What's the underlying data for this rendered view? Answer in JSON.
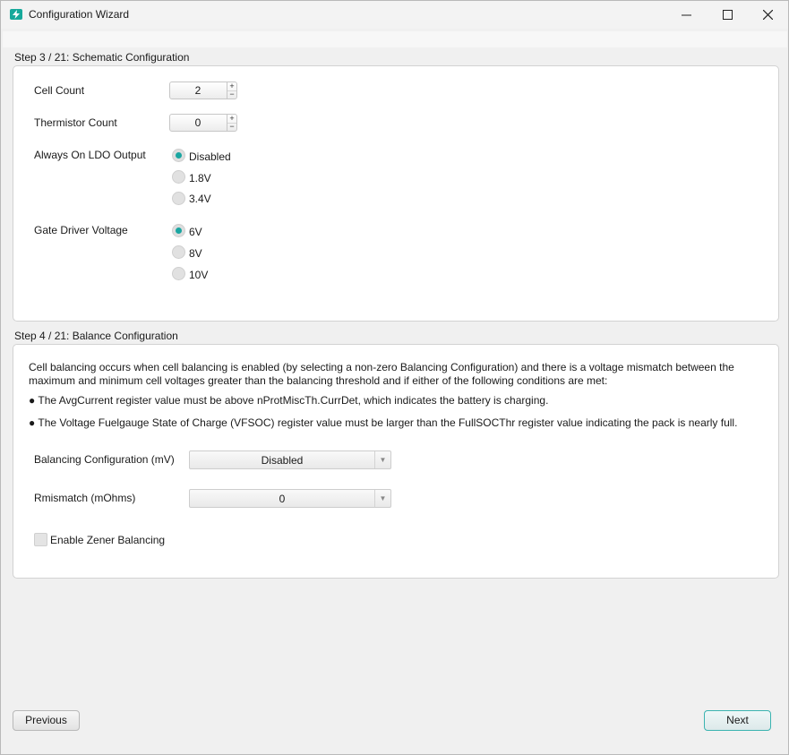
{
  "window": {
    "title": "Configuration Wizard",
    "icon": "lightning-bolt-icon",
    "controls": [
      "minimize-icon",
      "maximize-icon",
      "close-icon"
    ]
  },
  "step3": {
    "title": "Step 3 / 21: Schematic Configuration",
    "cell_count": {
      "label": "Cell Count",
      "value": "2"
    },
    "thermistor_count": {
      "label": "Thermistor Count",
      "value": "0"
    },
    "ldo": {
      "label": "Always On LDO Output",
      "options": [
        "Disabled",
        "1.8V",
        "3.4V"
      ],
      "selected": "Disabled"
    },
    "gate": {
      "label": "Gate Driver Voltage",
      "options": [
        "6V",
        "8V",
        "10V"
      ],
      "selected": "6V"
    }
  },
  "step4": {
    "title": "Step 4 / 21: Balance Configuration",
    "intro_line1": "Cell balancing occurs when cell balancing is enabled (by selecting a non-zero Balancing Configuration) and there is a voltage mismatch between the",
    "intro_line2": "maximum and minimum cell voltages greater than the balancing threshold and if either of the following conditions are met:",
    "bullet1": "● The AvgCurrent register value must be above nProtMiscTh.CurrDet, which indicates the battery is charging.",
    "bullet2": "● The Voltage Fuelgauge State of Charge (VFSOC) register value must be larger than the FullSOCThr register value indicating the pack is nearly full.",
    "balancing": {
      "label": "Balancing Configuration (mV)",
      "value": "Disabled"
    },
    "rmismatch": {
      "label": "Rmismatch (mOhms)",
      "value": "0"
    },
    "zener": {
      "label": "Enable Zener Balancing",
      "checked": false
    }
  },
  "footer": {
    "previous": "Previous",
    "next": "Next"
  },
  "colors": {
    "accent": "#1aa6a1",
    "app_icon": "#17a99b"
  }
}
